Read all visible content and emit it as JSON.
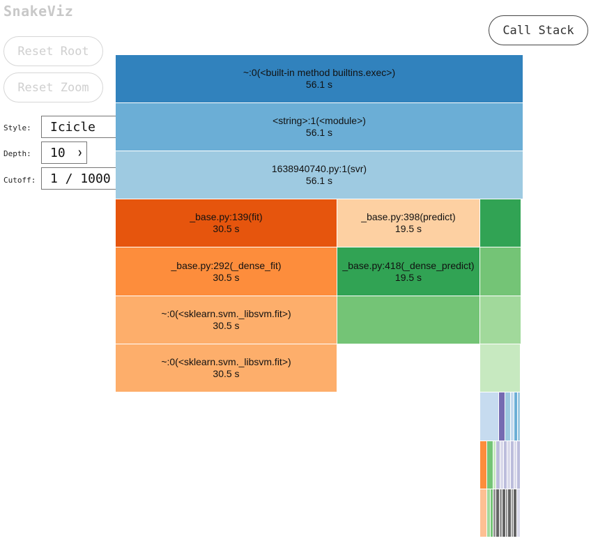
{
  "app": {
    "title": "SnakeViz"
  },
  "buttons": {
    "reset_root": "Reset Root",
    "reset_zoom": "Reset Zoom",
    "call_stack": "Call Stack"
  },
  "controls": {
    "style": {
      "label": "Style:",
      "value": "Icicle"
    },
    "depth": {
      "label": "Depth:",
      "value": "10"
    },
    "cutoff": {
      "label": "Cutoff:",
      "value": "1 / 1000"
    }
  },
  "icicle": {
    "nodes": [
      {
        "name": "~:0(<built-in method builtins.exec>)",
        "time": "56.1 s",
        "color": "#3182bd"
      },
      {
        "name": "<string>:1(<module>)",
        "time": "56.1 s",
        "color": "#6baed6"
      },
      {
        "name": "1638940740.py:1(svr)",
        "time": "56.1 s",
        "color": "#9ecae1"
      },
      {
        "name": "_base.py:139(fit)",
        "time": "30.5 s",
        "color": "#e6550d"
      },
      {
        "name": "_base.py:398(predict)",
        "time": "19.5 s",
        "color": "#fdd0a2"
      },
      {
        "name": "_base.py:292(_dense_fit)",
        "time": "30.5 s",
        "color": "#fd8d3c"
      },
      {
        "name": "_base.py:418(_dense_predict)",
        "time": "19.5 s",
        "color": "#31a354"
      },
      {
        "name": "~:0(<sklearn.svm._libsvm.fit>)",
        "time": "30.5 s",
        "color": "#fdae6b"
      },
      {
        "name": "~:0(<sklearn.svm._libsvm.fit>)",
        "time": "30.5 s",
        "color": "#fdae6b"
      }
    ],
    "unlabeled_colors": [
      "#31a354",
      "#74c476",
      "#a1d99b",
      "#c7e9c0",
      "#c6dbef",
      "#756bb1",
      "#9ecae1",
      "#6baed6",
      "#fd8d3c",
      "#bcbddc",
      "#dadaeb",
      "#636363",
      "#969696"
    ]
  }
}
